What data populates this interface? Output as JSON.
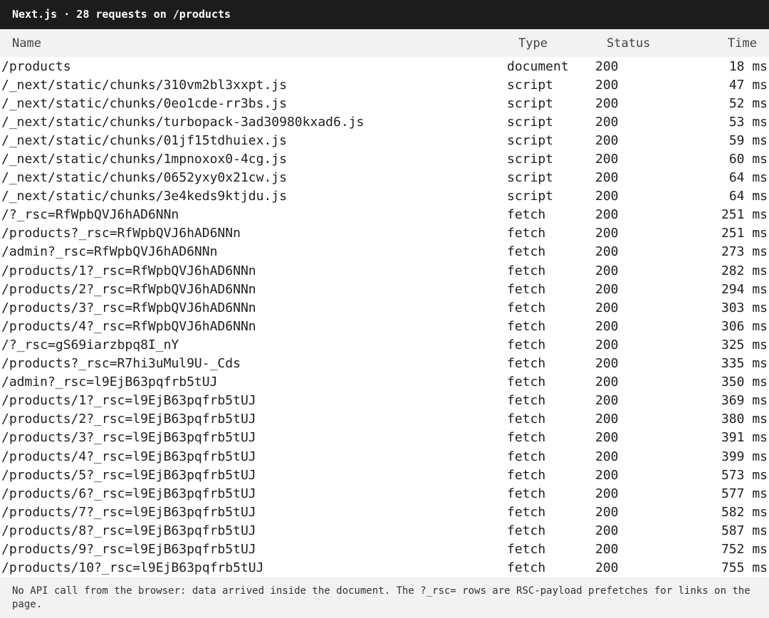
{
  "title": "Next.js · 28 requests on /products",
  "columns": {
    "name": "Name",
    "type": "Type",
    "status": "Status",
    "time": "Time"
  },
  "requests": [
    {
      "name": "/products",
      "type": "document",
      "status": "200",
      "time": "18 ms"
    },
    {
      "name": "/_next/static/chunks/310vm2bl3xxpt.js",
      "type": "script",
      "status": "200",
      "time": "47 ms"
    },
    {
      "name": "/_next/static/chunks/0eo1cde-rr3bs.js",
      "type": "script",
      "status": "200",
      "time": "52 ms"
    },
    {
      "name": "/_next/static/chunks/turbopack-3ad30980kxad6.js",
      "type": "script",
      "status": "200",
      "time": "53 ms"
    },
    {
      "name": "/_next/static/chunks/01jf15tdhuiex.js",
      "type": "script",
      "status": "200",
      "time": "59 ms"
    },
    {
      "name": "/_next/static/chunks/1mpnoxox0-4cg.js",
      "type": "script",
      "status": "200",
      "time": "60 ms"
    },
    {
      "name": "/_next/static/chunks/0652yxy0x21cw.js",
      "type": "script",
      "status": "200",
      "time": "64 ms"
    },
    {
      "name": "/_next/static/chunks/3e4keds9ktjdu.js",
      "type": "script",
      "status": "200",
      "time": "64 ms"
    },
    {
      "name": "/?_rsc=RfWpbQVJ6hAD6NNn",
      "type": "fetch",
      "status": "200",
      "time": "251 ms"
    },
    {
      "name": "/products?_rsc=RfWpbQVJ6hAD6NNn",
      "type": "fetch",
      "status": "200",
      "time": "251 ms"
    },
    {
      "name": "/admin?_rsc=RfWpbQVJ6hAD6NNn",
      "type": "fetch",
      "status": "200",
      "time": "273 ms"
    },
    {
      "name": "/products/1?_rsc=RfWpbQVJ6hAD6NNn",
      "type": "fetch",
      "status": "200",
      "time": "282 ms"
    },
    {
      "name": "/products/2?_rsc=RfWpbQVJ6hAD6NNn",
      "type": "fetch",
      "status": "200",
      "time": "294 ms"
    },
    {
      "name": "/products/3?_rsc=RfWpbQVJ6hAD6NNn",
      "type": "fetch",
      "status": "200",
      "time": "303 ms"
    },
    {
      "name": "/products/4?_rsc=RfWpbQVJ6hAD6NNn",
      "type": "fetch",
      "status": "200",
      "time": "306 ms"
    },
    {
      "name": "/?_rsc=gS69iarzbpq8I_nY",
      "type": "fetch",
      "status": "200",
      "time": "325 ms"
    },
    {
      "name": "/products?_rsc=R7hi3uMul9U-_Cds",
      "type": "fetch",
      "status": "200",
      "time": "335 ms"
    },
    {
      "name": "/admin?_rsc=l9EjB63pqfrb5tUJ",
      "type": "fetch",
      "status": "200",
      "time": "350 ms"
    },
    {
      "name": "/products/1?_rsc=l9EjB63pqfrb5tUJ",
      "type": "fetch",
      "status": "200",
      "time": "369 ms"
    },
    {
      "name": "/products/2?_rsc=l9EjB63pqfrb5tUJ",
      "type": "fetch",
      "status": "200",
      "time": "380 ms"
    },
    {
      "name": "/products/3?_rsc=l9EjB63pqfrb5tUJ",
      "type": "fetch",
      "status": "200",
      "time": "391 ms"
    },
    {
      "name": "/products/4?_rsc=l9EjB63pqfrb5tUJ",
      "type": "fetch",
      "status": "200",
      "time": "399 ms"
    },
    {
      "name": "/products/5?_rsc=l9EjB63pqfrb5tUJ",
      "type": "fetch",
      "status": "200",
      "time": "573 ms"
    },
    {
      "name": "/products/6?_rsc=l9EjB63pqfrb5tUJ",
      "type": "fetch",
      "status": "200",
      "time": "577 ms"
    },
    {
      "name": "/products/7?_rsc=l9EjB63pqfrb5tUJ",
      "type": "fetch",
      "status": "200",
      "time": "582 ms"
    },
    {
      "name": "/products/8?_rsc=l9EjB63pqfrb5tUJ",
      "type": "fetch",
      "status": "200",
      "time": "587 ms"
    },
    {
      "name": "/products/9?_rsc=l9EjB63pqfrb5tUJ",
      "type": "fetch",
      "status": "200",
      "time": "752 ms"
    },
    {
      "name": "/products/10?_rsc=l9EjB63pqfrb5tUJ",
      "type": "fetch",
      "status": "200",
      "time": "755 ms"
    }
  ],
  "footer_note": "No API call from the browser: data arrived inside the document. The ?_rsc= rows are RSC-payload prefetches for links on the page."
}
